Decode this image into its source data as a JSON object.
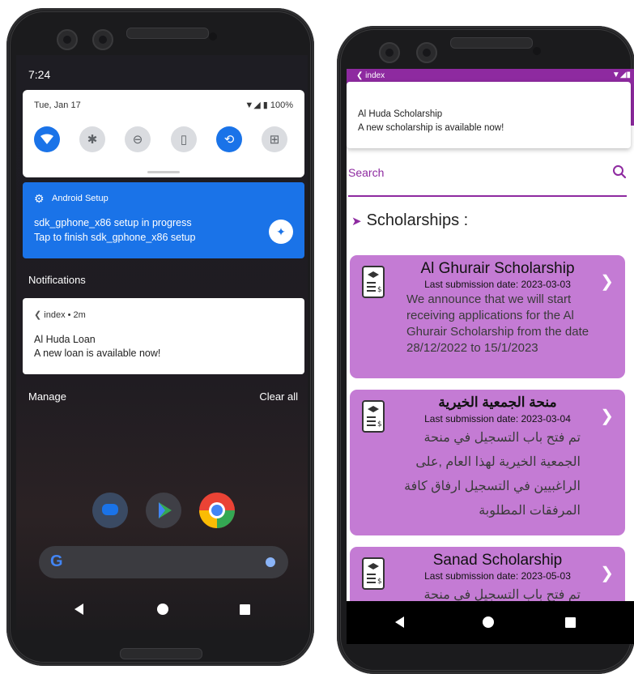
{
  "left_phone": {
    "status_time": "7:24",
    "date": "Tue, Jan 17",
    "battery_text": "100%",
    "quick_settings": [
      "wifi-icon",
      "bluetooth-icon",
      "do-not-disturb-icon",
      "flashlight-icon",
      "auto-rotate-icon",
      "battery-saver-icon"
    ],
    "setup_notification": {
      "app": "Android Setup",
      "line1": "sdk_gphone_x86 setup in progress",
      "line2": "Tap to finish sdk_gphone_x86 setup"
    },
    "notifications_header": "Notifications",
    "notification": {
      "app": "index • 2m",
      "title": "Al Huda Loan",
      "body": "A new loan is available now!"
    },
    "manage_label": "Manage",
    "clear_all_label": "Clear all",
    "search_logo": "G"
  },
  "right_phone": {
    "app_title": "index",
    "banner": {
      "title": "Al Huda Scholarship",
      "body": "A new scholarship is available now!"
    },
    "search_placeholder": "Search",
    "section_title": "Scholarships :",
    "scholarships": [
      {
        "title": "Al Ghurair Scholarship",
        "date": "Last submission date: 2023-03-03",
        "desc": "We announce that we will start receiving applications for the Al Ghurair Scholarship from the date 28/12/2022 to 15/1/2023"
      },
      {
        "title": "منحة الجمعية الخيرية",
        "date": "Last submission date: 2023-03-04",
        "desc": "تم فتح باب التسجيل في منحة الجمعية الخيرية لهذا العام ,على الراغبيين في التسجيل ارفاق كافة المرفقات المطلوبة"
      },
      {
        "title": "Sanad Scholarship",
        "date": "Last submission date: 2023-05-03",
        "desc": "تم فتح باب التسجيل في منحة"
      }
    ]
  },
  "colors": {
    "accent_purple": "#8e2aa0",
    "card_purple": "#c47bd4",
    "android_blue": "#1a73e8"
  }
}
